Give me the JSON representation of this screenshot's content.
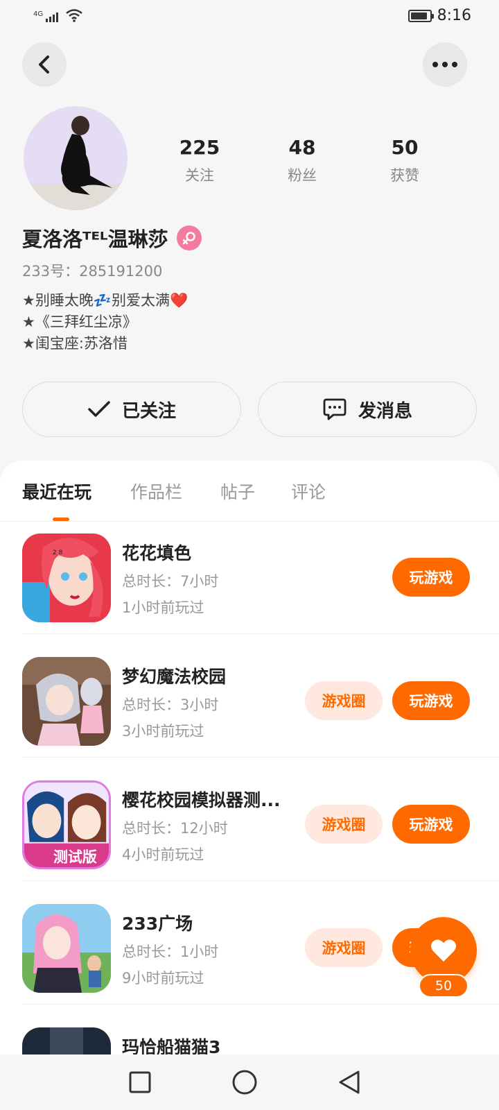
{
  "status_bar": {
    "network": "4G",
    "time": "8:16",
    "battery_level": 0.9
  },
  "header": {
    "back_icon": "chevron-left-icon",
    "more_icon": "more-dots-icon"
  },
  "profile": {
    "stats": [
      {
        "value": "225",
        "label": "关注"
      },
      {
        "value": "48",
        "label": "粉丝"
      },
      {
        "value": "50",
        "label": "获赞"
      }
    ],
    "nickname": "夏洛洛ᵀᴱᴸ温琳莎",
    "gender": "female",
    "user_id": "233号：285191200",
    "bio": [
      "★别睡太晚💤别爱太满❤️",
      "★《三拜红尘凉》",
      "★闺宝座:苏洛惜"
    ]
  },
  "actions": {
    "follow_label": "已关注",
    "message_label": "发消息"
  },
  "tabs": [
    {
      "label": "最近在玩",
      "active": true
    },
    {
      "label": "作品栏",
      "active": false
    },
    {
      "label": "帖子",
      "active": false
    },
    {
      "label": "评论",
      "active": false
    }
  ],
  "games": [
    {
      "name": "花花填色",
      "duration": "总时长：7小时",
      "last_played": "1小时前玩过",
      "has_circle": false,
      "circle_label": "游戏圈",
      "play_label": "玩游戏"
    },
    {
      "name": "梦幻魔法校园",
      "duration": "总时长：3小时",
      "last_played": "3小时前玩过",
      "has_circle": true,
      "circle_label": "游戏圈",
      "play_label": "玩游戏"
    },
    {
      "name": "樱花校园模拟器测...",
      "duration": "总时长：12小时",
      "last_played": "4小时前玩过",
      "has_circle": true,
      "circle_label": "游戏圈",
      "play_label": "玩游戏"
    },
    {
      "name": "233广场",
      "duration": "总时长：1小时",
      "last_played": "9小时前玩过",
      "has_circle": true,
      "circle_label": "游戏圈",
      "play_label": "玩游戏"
    },
    {
      "name": "玛恰船猫猫3"
    }
  ],
  "floating_like": {
    "count": "50",
    "icon": "heart-icon"
  },
  "colors": {
    "accent": "#ff6a00",
    "accent_light": "#ffe9df",
    "gender_badge": "#f47aa0"
  }
}
